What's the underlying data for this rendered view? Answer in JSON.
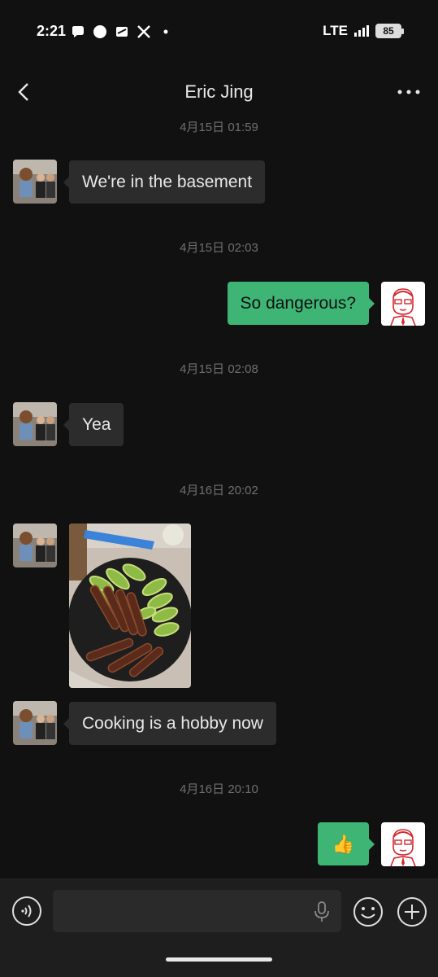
{
  "status_bar": {
    "time": "2:21",
    "network": "LTE",
    "battery": "85"
  },
  "header": {
    "title": "Eric Jing"
  },
  "messages": [
    {
      "type": "timestamp",
      "text": "4月15日 01:59"
    },
    {
      "type": "incoming",
      "text": "We're in the basement"
    },
    {
      "type": "timestamp",
      "text": "4月15日 02:03"
    },
    {
      "type": "outgoing",
      "text": "So dangerous?"
    },
    {
      "type": "timestamp",
      "text": "4月15日 02:08"
    },
    {
      "type": "incoming",
      "text": "Yea"
    },
    {
      "type": "timestamp",
      "text": "4月16日 20:02"
    },
    {
      "type": "incoming-image",
      "image": "food-photo"
    },
    {
      "type": "incoming",
      "text": "Cooking is a hobby now"
    },
    {
      "type": "timestamp",
      "text": "4月16日 20:10"
    },
    {
      "type": "outgoing",
      "text": "👍"
    }
  ],
  "input_bar": {
    "placeholder": ""
  },
  "colors": {
    "outgoing_bubble": "#3eb575",
    "incoming_bubble": "#2c2c2c",
    "background": "#111111"
  }
}
